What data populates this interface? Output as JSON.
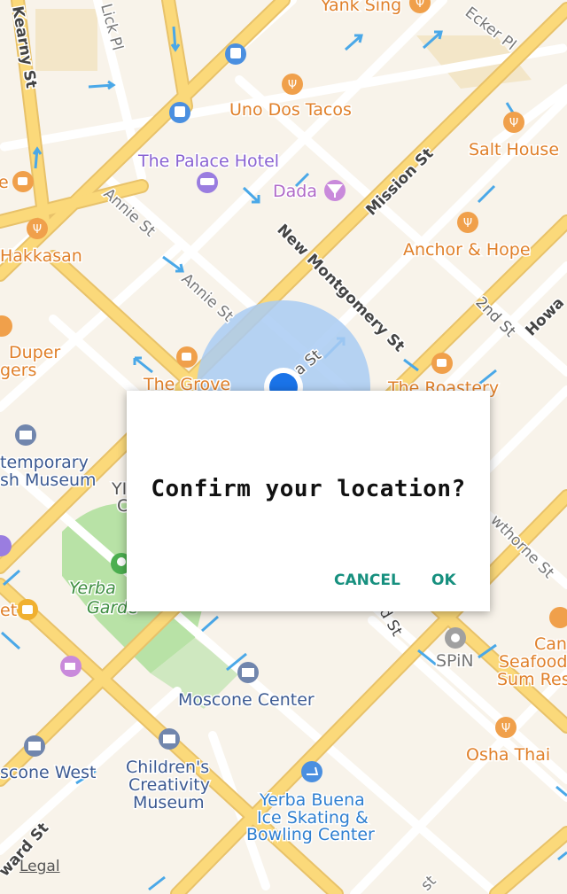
{
  "colors": {
    "background": "#f8f3ea",
    "major_road": "#fbd97a",
    "minor_road": "#ffffff",
    "park": "#b8e2a6",
    "accuracy_circle": "#a9cbf3",
    "location_dot": "#1a73e8",
    "poi_food": "#f0a04b",
    "poi_food_text": "#e0802a",
    "poi_museum": "#6b7fa6",
    "poi_museum_text": "#3c5a92",
    "dialog_button": "#17907f"
  },
  "streets": {
    "kearny": "Kearny St",
    "lick": "Lick Pl",
    "ecker": "Ecker Pl",
    "mission": "Mission St",
    "new_montgomery": "New Montgomery St",
    "annie_1": "Annie St",
    "annie_2": "Annie St",
    "second": "2nd St",
    "howard": "Howa",
    "hawthorne": "wthorne St",
    "third_frag": "d St",
    "ward": "ward St",
    "bottom_frag": "st",
    "jessie_frag": "a St"
  },
  "pois": [
    {
      "name": "Yank Sing",
      "icon": "restaurant-icon"
    },
    {
      "name": "Uno Dos Tacos",
      "icon": "restaurant-icon"
    },
    {
      "name": "The Palace Hotel",
      "icon": "hotel-icon"
    },
    {
      "name": "Dada",
      "icon": "bar-icon"
    },
    {
      "name": "Salt House",
      "icon": "restaurant-icon"
    },
    {
      "name": "Anchor & Hope",
      "icon": "restaurant-icon"
    },
    {
      "name": "Hakkasan",
      "icon": "restaurant-icon"
    },
    {
      "name": "e",
      "icon": "cafe-icon"
    },
    {
      "name": "Duper",
      "icon": "restaurant-icon"
    },
    {
      "name": "gers",
      "icon": "none"
    },
    {
      "name": "The Grove",
      "icon": "cafe-icon"
    },
    {
      "name": "The Roastery",
      "icon": "cafe-icon"
    },
    {
      "name": "temporary",
      "icon": "museum-icon"
    },
    {
      "name": "sh Museum",
      "icon": "none"
    },
    {
      "name": "YI",
      "icon": "none"
    },
    {
      "name": "C",
      "icon": "none"
    },
    {
      "name": "Yerba",
      "icon": "park-icon"
    },
    {
      "name": "Garde",
      "icon": "none"
    },
    {
      "name": "et",
      "icon": "shopping-icon"
    },
    {
      "name": "Moscone Center",
      "icon": "convention-icon"
    },
    {
      "name": "scone West",
      "icon": "convention-icon"
    },
    {
      "name": "Children's",
      "icon": "museum-icon"
    },
    {
      "name": "Creativity",
      "icon": "none"
    },
    {
      "name": "Museum",
      "icon": "none"
    },
    {
      "name": "Yerba Buena",
      "icon": "skating-icon"
    },
    {
      "name": "Ice Skating &",
      "icon": "none"
    },
    {
      "name": "Bowling Center",
      "icon": "none"
    },
    {
      "name": "SPiN",
      "icon": "pin-icon"
    },
    {
      "name": "Can",
      "icon": "restaurant-icon"
    },
    {
      "name": "Seafood",
      "icon": "none"
    },
    {
      "name": "Sum Res",
      "icon": "none"
    },
    {
      "name": "Osha Thai",
      "icon": "restaurant-icon"
    }
  ],
  "dialog": {
    "title": "Confirm your location?",
    "cancel_label": "CANCEL",
    "ok_label": "OK"
  },
  "footer": {
    "legal": "Legal"
  }
}
